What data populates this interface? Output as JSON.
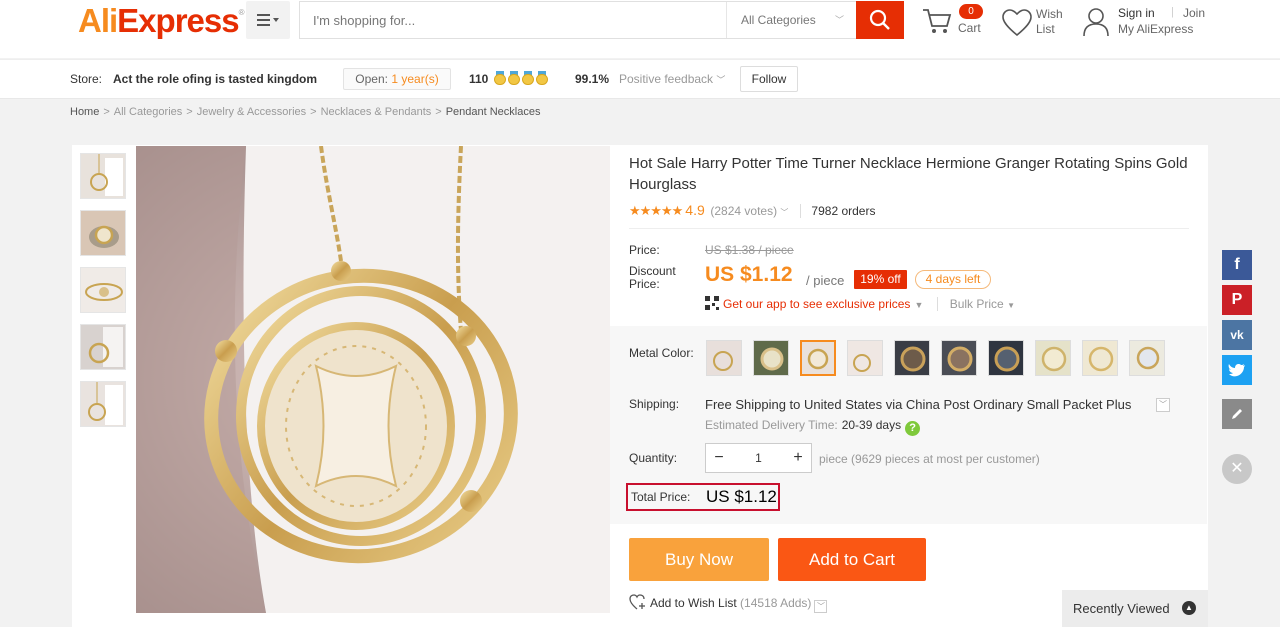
{
  "header": {
    "logo_text": "AliExpress",
    "logo_mark": "®",
    "search_placeholder": "I'm shopping for...",
    "category_select": "All Categories",
    "cart_count": "0",
    "cart_label": "Cart",
    "wish_label_1": "Wish",
    "wish_label_2": "List",
    "sign_in": "Sign in",
    "separator": "|",
    "join": "Join",
    "my_aliexpress": "My AliExpress"
  },
  "store": {
    "label": "Store:",
    "name": "Act the role ofing is tasted kingdom",
    "open_label": "Open:",
    "open_years": "1 year(s)",
    "score": "110",
    "feedback_pct": "99.1%",
    "feedback_label": "Positive feedback",
    "follow": "Follow"
  },
  "breadcrumb": [
    "Home",
    "All Categories",
    "Jewelry & Accessories",
    "Necklaces & Pendants",
    "Pendant Necklaces"
  ],
  "product": {
    "title": "Hot Sale Harry Potter Time Turner Necklace Hermione Granger Rotating Spins Gold Hourglass",
    "stars": "★★★★★",
    "rating": "4.9",
    "votes": "(2824 votes)",
    "orders": "7982 orders",
    "price_label": "Price:",
    "old_price": "US $1.38 / piece",
    "discount_label": "Discount Price:",
    "discount_price": "US $1.12",
    "per_piece": "/ piece",
    "off": "19% off",
    "days_left": "4 days left",
    "app_link": "Get our app to see exclusive prices",
    "bulk": "Bulk Price",
    "metal_label": "Metal Color:",
    "shipping_label": "Shipping:",
    "shipping_bold": "Free Shipping to",
    "shipping_rest": "United States via China Post Ordinary Small Packet Plus",
    "delivery_label": "Estimated Delivery Time:",
    "delivery_days": "20-39 days",
    "quantity_label": "Quantity:",
    "quantity": "1",
    "quantity_note": "piece (9629 pieces at most per customer)",
    "total_label": "Total Price:",
    "total": "US $1.12",
    "buy_now": "Buy Now",
    "add_to_cart": "Add to Cart",
    "wishlist": "Add to Wish List",
    "wishlist_count": "(14518 Adds)"
  },
  "recently_viewed": "Recently Viewed",
  "colors": {
    "brand_red": "#e62e04",
    "brand_orange": "#f68b1f",
    "buy_now": "#f9a23c",
    "add_to_cart": "#fa5714",
    "highlight_box": "#c8102e"
  }
}
